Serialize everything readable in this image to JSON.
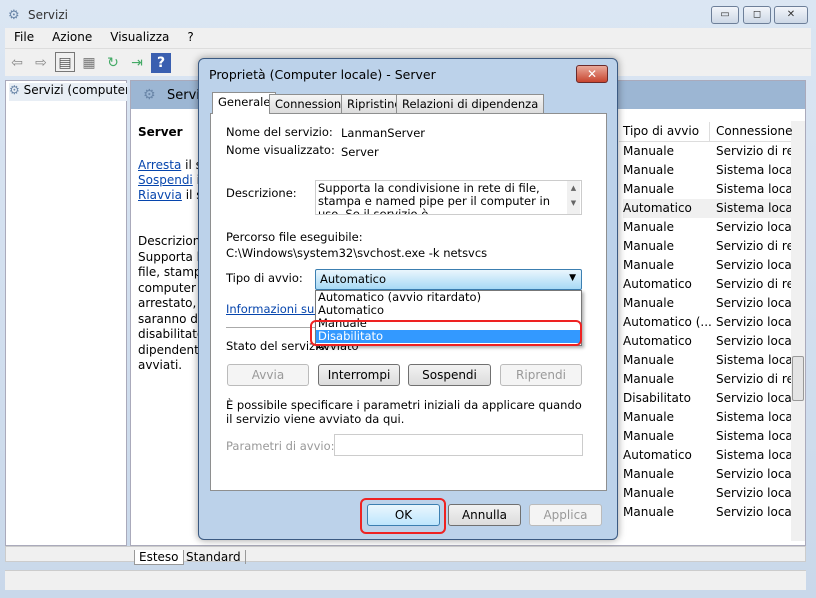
{
  "window": {
    "title": "Servizi",
    "min": "▭",
    "max": "◻",
    "close": "✕"
  },
  "menu": [
    "File",
    "Azione",
    "Visualizza",
    "?"
  ],
  "tree": {
    "root": "Servizi (computer"
  },
  "right_header": {
    "title": "Servizi"
  },
  "detail": {
    "name": "Server",
    "links": [
      {
        "link": "Arresta",
        "rest": " il se"
      },
      {
        "link": "Sospendi",
        "rest": " il"
      },
      {
        "link": "Riavvia",
        "rest": " il se"
      }
    ],
    "desc_lines": [
      "Descrizione",
      "Supporta la",
      "file, stampa",
      "computer i",
      "arrestato, q",
      "saranno dis",
      "disabilitato,",
      "dipendenti",
      "avviati."
    ]
  },
  "list": {
    "columns": [
      "Tipo di avvio",
      "Connessione"
    ],
    "rows": [
      [
        "Manuale",
        "Servizio di rete"
      ],
      [
        "Manuale",
        "Sistema locale"
      ],
      [
        "Manuale",
        "Sistema locale"
      ],
      [
        "Automatico",
        "Sistema locale"
      ],
      [
        "Manuale",
        "Servizio locale"
      ],
      [
        "Manuale",
        "Servizio di rete"
      ],
      [
        "Manuale",
        "Servizio locale"
      ],
      [
        "Automatico",
        "Servizio di rete"
      ],
      [
        "Manuale",
        "Servizio locale"
      ],
      [
        "Automatico (...",
        "Servizio locale"
      ],
      [
        "Automatico",
        "Servizio locale"
      ],
      [
        "Manuale",
        "Sistema locale"
      ],
      [
        "Manuale",
        "Servizio di rete"
      ],
      [
        "Disabilitato",
        "Servizio locale"
      ],
      [
        "Manuale",
        "Sistema locale"
      ],
      [
        "Manuale",
        "Sistema locale"
      ],
      [
        "Automatico",
        "Sistema locale"
      ],
      [
        "Manuale",
        "Servizio locale"
      ],
      [
        "Manuale",
        "Servizio locale"
      ],
      [
        "Manuale",
        "Servizio locale"
      ]
    ]
  },
  "bottom_tabs": [
    "Esteso",
    "Standard"
  ],
  "dialog": {
    "title": "Proprietà (Computer locale) - Server",
    "close": "✕",
    "tabs": [
      "Generale",
      "Connessione",
      "Ripristino",
      "Relazioni di dipendenza"
    ],
    "service_name_label": "Nome del servizio:",
    "service_name": "LanmanServer",
    "display_name_label": "Nome visualizzato:",
    "display_name": "Server",
    "desc_label": "Descrizione:",
    "desc": "Supporta la condivisione in rete di file, stampa e named pipe per il computer in uso. Se il servizio è",
    "path_label": "Percorso file eseguibile:",
    "path": "C:\\Windows\\system32\\svchost.exe -k netsvcs",
    "startup_label": "Tipo di avvio:",
    "startup_value": "Automatico",
    "startup_options": [
      "Automatico (avvio ritardato)",
      "Automatico",
      "Manuale",
      "Disabilitato"
    ],
    "info_link": "Informazioni sulla c",
    "status_label": "Stato del servizio:",
    "status_value": "Avviato",
    "buttons": [
      "Avvia",
      "Interrompi",
      "Sospendi",
      "Riprendi"
    ],
    "hint": "È possibile specificare i parametri iniziali da applicare quando il servizio viene avviato da qui.",
    "params_label": "Parametri di avvio:",
    "ok": "OK",
    "cancel": "Annulla",
    "apply": "Applica"
  }
}
